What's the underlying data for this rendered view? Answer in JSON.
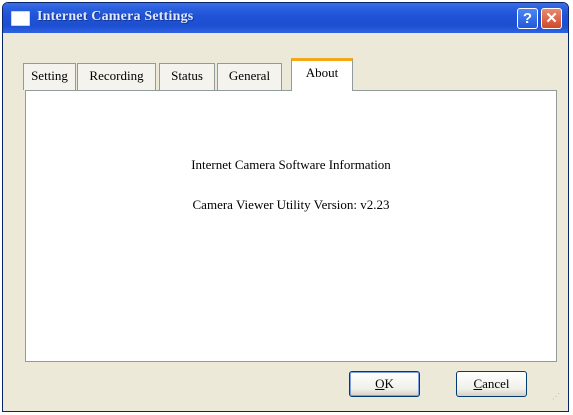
{
  "window": {
    "title": "Internet Camera Settings",
    "help_label": "?",
    "close_label": "✕"
  },
  "tabs": [
    {
      "label": "Setting",
      "active": false
    },
    {
      "label": "Recording",
      "active": false
    },
    {
      "label": "Status",
      "active": false
    },
    {
      "label": "General",
      "active": false
    },
    {
      "label": "About",
      "active": true
    }
  ],
  "about": {
    "line1": "Internet Camera Software Information",
    "line2": "Camera Viewer Utility Version: v2.23"
  },
  "buttons": {
    "ok_underline": "O",
    "ok_rest": "K",
    "cancel_underline": "C",
    "cancel_rest": "ancel"
  },
  "colors": {
    "titlebar": "#1f52d6",
    "active_tab_accent": "#f5a71a",
    "dialog_bg": "#ece9d8"
  },
  "icons": {
    "window": "window-app-icon",
    "help": "help-icon",
    "close": "close-icon",
    "resize": "resize-grip-icon"
  }
}
